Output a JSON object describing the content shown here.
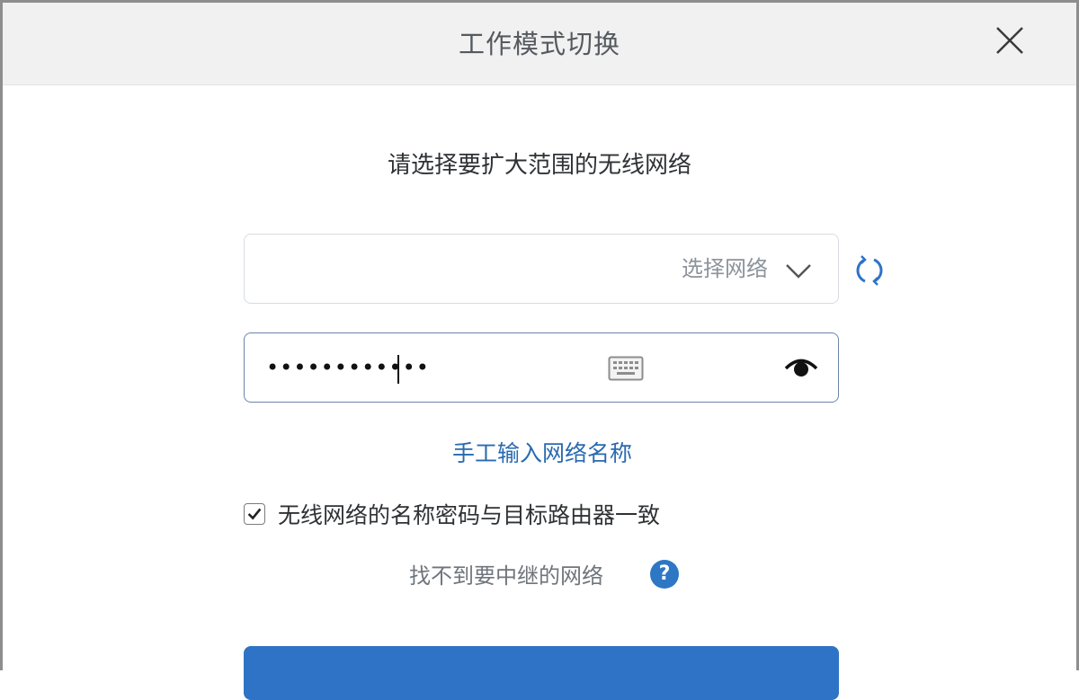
{
  "dialog": {
    "title": "工作模式切换",
    "close_icon": "close-icon"
  },
  "prompt": {
    "text": "请选择要扩大范围的无线网络"
  },
  "network_select": {
    "placeholder": "选择网络",
    "dropdown_icon": "chevron-down-icon",
    "refresh_icon": "refresh-icon"
  },
  "password": {
    "value": "••••••••••••",
    "keyboard_icon": "keyboard-icon",
    "visibility_icon": "eye-icon"
  },
  "manual_entry": {
    "label": "手工输入网络名称"
  },
  "same_credentials": {
    "label": "无线网络的名称密码与目标路由器一致",
    "checked": true
  },
  "help": {
    "label": "找不到要中继的网络",
    "icon": "?"
  },
  "colors": {
    "accent": "#2e73c6",
    "link": "#2a6ab0",
    "header_bg": "#f1f1f1"
  }
}
